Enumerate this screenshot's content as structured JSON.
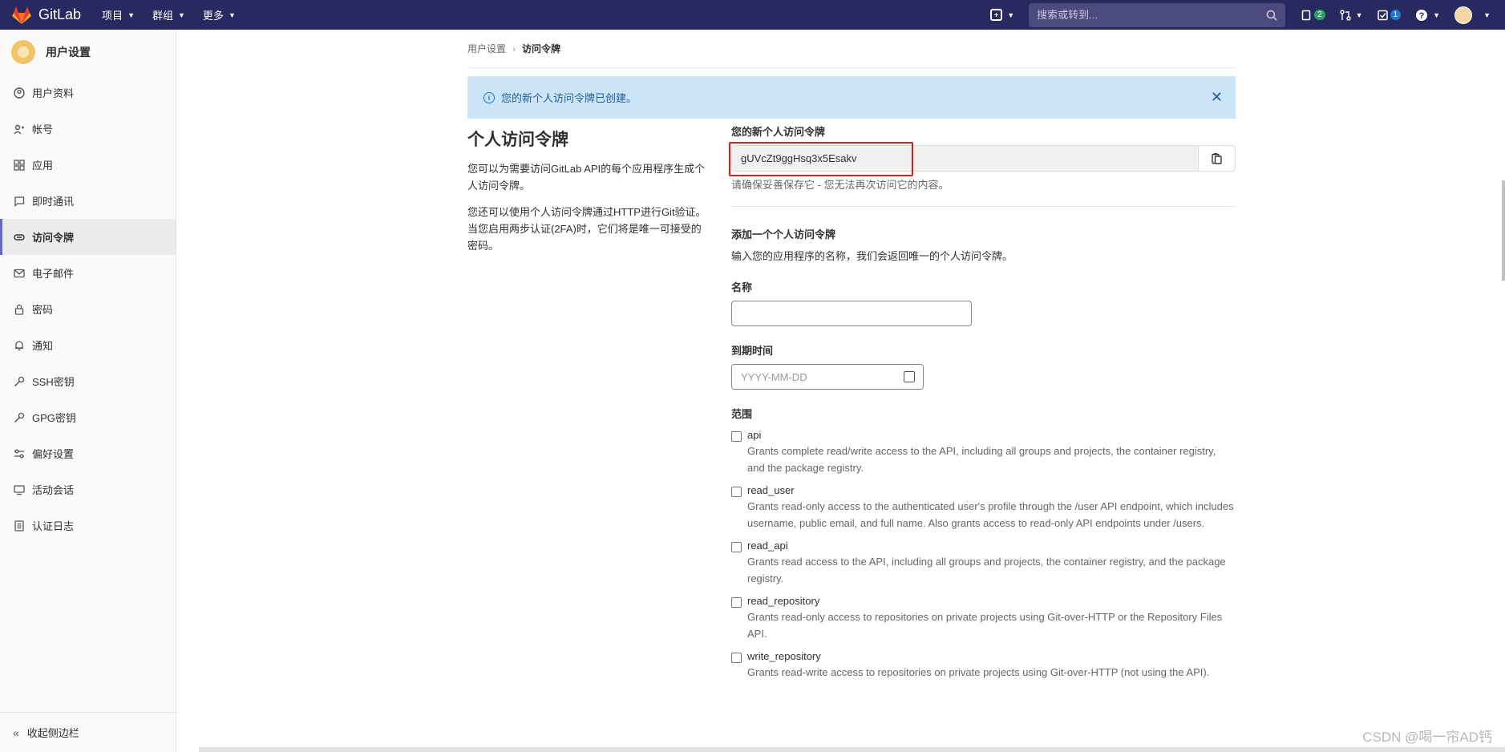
{
  "topnav": {
    "brand": "GitLab",
    "menu": [
      {
        "label": "项目"
      },
      {
        "label": "群组"
      },
      {
        "label": "更多"
      }
    ],
    "search_placeholder": "搜索或转到...",
    "issues_count": "2",
    "todos_count": "1",
    "icons": [
      "plus-icon",
      "search-icon",
      "issues-icon",
      "merge-request-icon",
      "todo-icon",
      "help-icon",
      "avatar"
    ]
  },
  "sidebar": {
    "title": "用户设置",
    "items": [
      {
        "label": "用户资料",
        "icon": "profile-icon"
      },
      {
        "label": "帐号",
        "icon": "account-icon"
      },
      {
        "label": "应用",
        "icon": "applications-icon"
      },
      {
        "label": "即时通讯",
        "icon": "chat-icon"
      },
      {
        "label": "访问令牌",
        "icon": "token-icon",
        "active": true
      },
      {
        "label": "电子邮件",
        "icon": "mail-icon"
      },
      {
        "label": "密码",
        "icon": "lock-icon"
      },
      {
        "label": "通知",
        "icon": "bell-icon"
      },
      {
        "label": "SSH密钥",
        "icon": "key-icon"
      },
      {
        "label": "GPG密钥",
        "icon": "key-icon"
      },
      {
        "label": "偏好设置",
        "icon": "preferences-icon"
      },
      {
        "label": "活动会话",
        "icon": "monitor-icon"
      },
      {
        "label": "认证日志",
        "icon": "log-icon"
      }
    ],
    "collapse_label": "收起侧边栏"
  },
  "breadcrumb": {
    "parent": "用户设置",
    "current": "访问令牌"
  },
  "alert": {
    "text": "您的新个人访问令牌已创建。"
  },
  "intro": {
    "title": "个人访问令牌",
    "para1": "您可以为需要访问GitLab API的每个应用程序生成个人访问令牌。",
    "para2": "您还可以使用个人访问令牌通过HTTP进行Git验证。 当您启用两步认证(2FA)时，它们将是唯一可接受的密码。"
  },
  "new_token": {
    "label": "您的新个人访问令牌",
    "value": "gUVcZt9ggHsq3x5Esakv",
    "help": "请确保妥善保存它 - 您无法再次访问它的内容。"
  },
  "form": {
    "heading": "添加一个个人访问令牌",
    "subheading": "输入您的应用程序的名称，我们会返回唯一的个人访问令牌。",
    "name_label": "名称",
    "name_value": "",
    "expires_label": "到期时间",
    "expires_placeholder": "YYYY-MM-DD",
    "scopes_label": "范围",
    "scopes": [
      {
        "name": "api",
        "desc": "Grants complete read/write access to the API, including all groups and projects, the container registry, and the package registry.",
        "checked": false
      },
      {
        "name": "read_user",
        "desc": "Grants read-only access to the authenticated user's profile through the /user API endpoint, which includes username, public email, and full name. Also grants access to read-only API endpoints under /users.",
        "checked": false
      },
      {
        "name": "read_api",
        "desc": "Grants read access to the API, including all groups and projects, the container registry, and the package registry.",
        "checked": false
      },
      {
        "name": "read_repository",
        "desc": "Grants read-only access to repositories on private projects using Git-over-HTTP or the Repository Files API.",
        "checked": false
      },
      {
        "name": "write_repository",
        "desc": "Grants read-write access to repositories on private projects using Git-over-HTTP (not using the API).",
        "checked": false
      }
    ]
  },
  "watermark": "CSDN @喝一帘AD钙",
  "colors": {
    "topnav_bg": "#292961",
    "alert_bg": "#cce4f7",
    "highlight": "#e11b1b",
    "active_bar": "#6666c4"
  }
}
